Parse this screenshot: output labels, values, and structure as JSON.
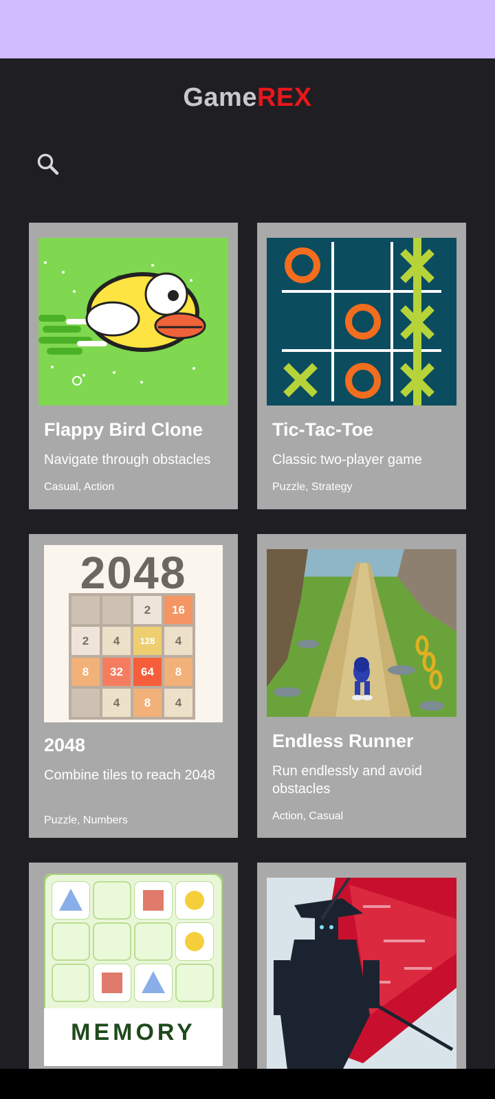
{
  "app": {
    "title_part1": "Game",
    "title_part2": "REX",
    "title_color1": "#c9c8cd",
    "title_color2": "#e8171b",
    "search_icon": "search-icon"
  },
  "games": [
    {
      "name": "Flappy Bird Clone",
      "description": "Navigate through obstacles",
      "tags": "Casual, Action"
    },
    {
      "name": "Tic-Tac-Toe",
      "description": "Classic two-player game",
      "tags": "Puzzle, Strategy"
    },
    {
      "name": "2048",
      "description": "Combine tiles to reach 2048",
      "tags": "Puzzle, Numbers"
    },
    {
      "name": "Endless Runner",
      "description": "Run endlessly and avoid obstacles",
      "tags": "Action, Casual"
    },
    {
      "name": "",
      "description": "",
      "tags": ""
    },
    {
      "name": "",
      "description": "",
      "tags": ""
    }
  ],
  "tiles_2048": {
    "logo": "2048",
    "rows": [
      [
        "",
        "",
        "2",
        "16"
      ],
      [
        "2",
        "4",
        "128",
        "4"
      ],
      [
        "8",
        "32",
        "64",
        "8"
      ],
      [
        "",
        "4",
        "8",
        "4"
      ]
    ]
  },
  "memory_logo": "MEMORY",
  "colors": {
    "status_bar": "#d0bcff",
    "background": "#1f1e23",
    "card": "#a9a9a9"
  }
}
